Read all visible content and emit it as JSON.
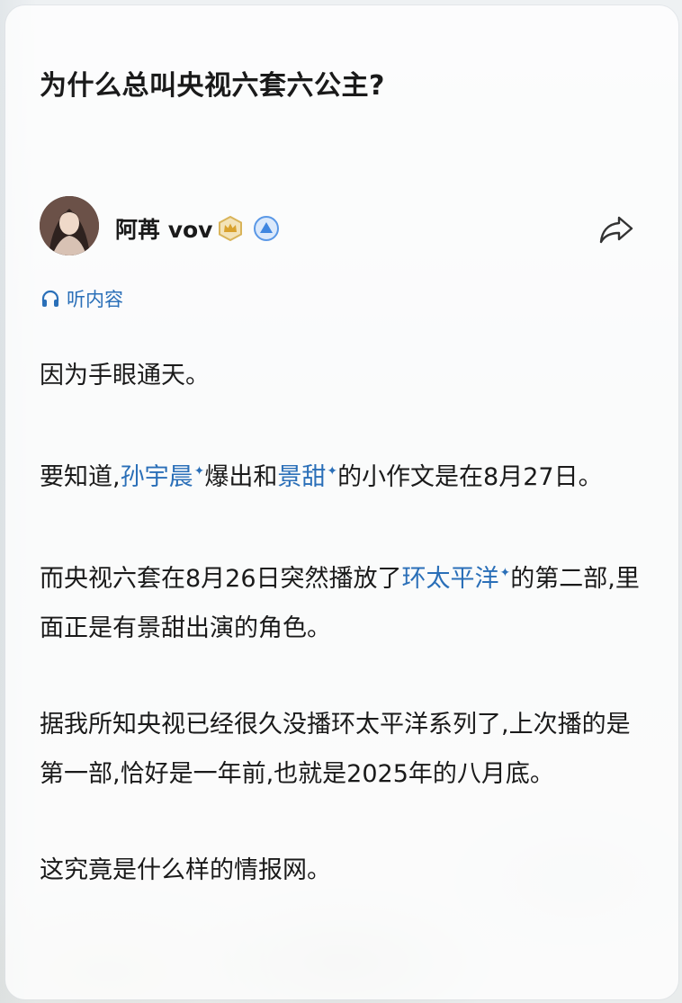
{
  "question": {
    "title": "为什么总叫央视六套六公主?"
  },
  "author": {
    "name": "阿苒 vov",
    "badges": [
      "crown-badge-icon",
      "level-up-badge-icon"
    ]
  },
  "actions": {
    "share_icon": "share-arrow-icon"
  },
  "listen": {
    "icon": "headphones-icon",
    "label": "听内容"
  },
  "answer": {
    "p1": "因为手眼通天。",
    "p2": {
      "t1": "要知道,",
      "link1": "孙宇晨",
      "t2": "爆出和",
      "link2": "景甜",
      "t3": "的小作文是在8月27日。"
    },
    "p3": {
      "t1": "而央视六套在8月26日突然播放了",
      "link1": "环太平洋",
      "t2": "的第二部,里面正是有景甜出演的角色。"
    },
    "p4": "据我所知央视已经很久没播环太平洋系列了,上次播的是第一部,恰好是一年前,也就是2025年的八月底。",
    "p5": "这究竟是什么样的情报网。"
  },
  "colors": {
    "link": "#2a6fb8",
    "text": "#1a1a1a"
  }
}
